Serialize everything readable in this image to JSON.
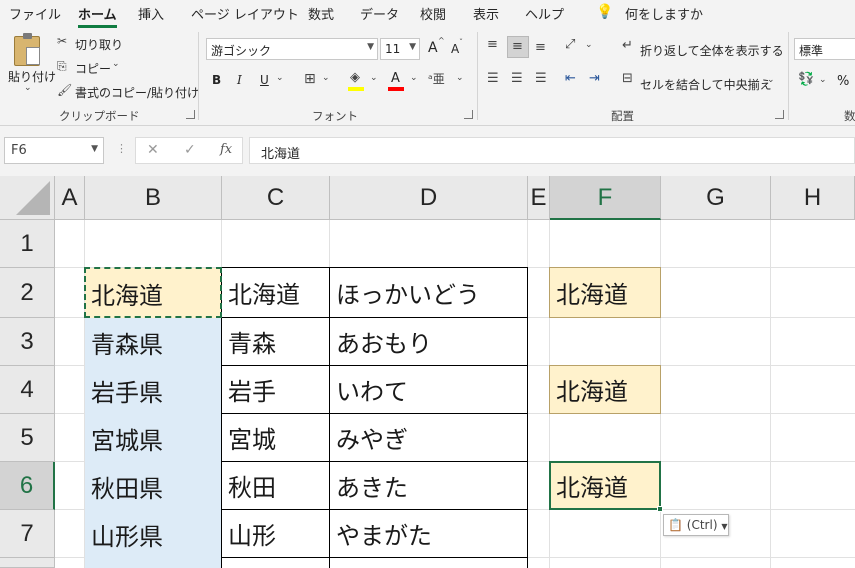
{
  "menu_tabs": [
    "ファイル",
    "ホーム",
    "挿入",
    "ページ レイアウト",
    "数式",
    "データ",
    "校閲",
    "表示",
    "ヘルプ"
  ],
  "active_tab": "ホーム",
  "tell_me": "何をしますか",
  "ribbon": {
    "clipboard": {
      "group": "クリップボード",
      "paste": "貼り付け",
      "cut": "切り取り",
      "copy": "コピー",
      "format_painter": "書式のコピー/貼り付け"
    },
    "font": {
      "group": "フォント",
      "font_name": "游ゴシック",
      "font_size": "11",
      "bold": "B",
      "italic": "I",
      "underline": "U",
      "grow": "A",
      "shrink": "A",
      "font_color_letter": "A",
      "fill_color": "#ffff00",
      "font_color": "#ff0000"
    },
    "alignment": {
      "group": "配置",
      "wrap_text": "折り返して全体を表示する",
      "merge_center": "セルを結合して中央揃え"
    },
    "number": {
      "format": "標準",
      "percent": "%",
      "group_partial": "数"
    }
  },
  "formula_bar": {
    "name_box": "F6",
    "fx": "fx",
    "cancel": "✕",
    "enter": "✓",
    "content": "北海道"
  },
  "columns": [
    "A",
    "B",
    "C",
    "D",
    "E",
    "F",
    "G",
    "H"
  ],
  "rows": [
    "1",
    "2",
    "3",
    "4",
    "5",
    "6",
    "7"
  ],
  "selected_column": "F",
  "selected_row": "6",
  "table": [
    [
      "北海道",
      "北海道",
      "ほっかいどう"
    ],
    [
      "青森県",
      "青森",
      "あおもり"
    ],
    [
      "岩手県",
      "岩手",
      "いわて"
    ],
    [
      "宮城県",
      "宮城",
      "みやぎ"
    ],
    [
      "秋田県",
      "秋田",
      "あきた"
    ],
    [
      "山形県",
      "山形",
      "やまがた"
    ]
  ],
  "col_f": {
    "F2": "北海道",
    "F4": "北海道",
    "F6": "北海道"
  },
  "paste_options": "(Ctrl)",
  "colors": {
    "accent_green": "#217346",
    "fill_blue": "#ddebf7",
    "fill_cream": "#fff2cc"
  }
}
